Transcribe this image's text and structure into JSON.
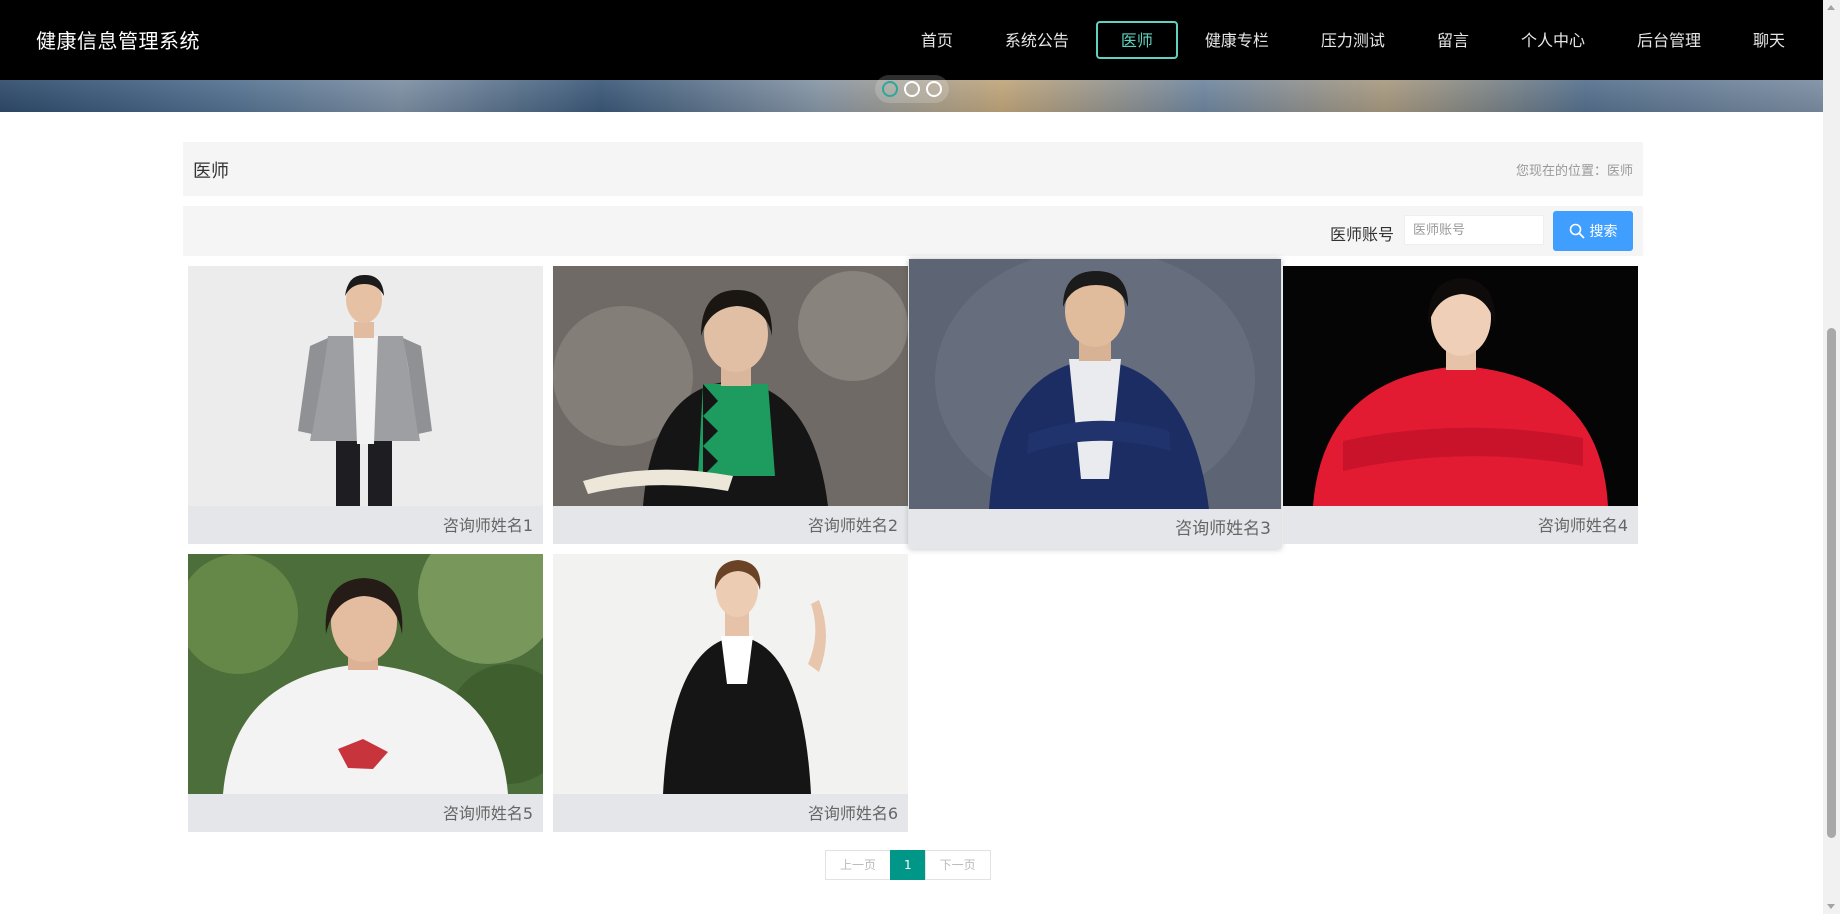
{
  "app": {
    "title": "健康信息管理系统"
  },
  "nav": {
    "items": [
      {
        "label": "首页",
        "active": false
      },
      {
        "label": "系统公告",
        "active": false
      },
      {
        "label": "医师",
        "active": true
      },
      {
        "label": "健康专栏",
        "active": false
      },
      {
        "label": "压力测试",
        "active": false
      },
      {
        "label": "留言",
        "active": false
      },
      {
        "label": "个人中心",
        "active": false
      },
      {
        "label": "后台管理",
        "active": false
      },
      {
        "label": "聊天",
        "active": false
      }
    ]
  },
  "carousel": {
    "slide_count": 3,
    "active_index": 0
  },
  "breadcrumb": {
    "title": "医师",
    "location_prefix": "您现在的位置：",
    "location_current": "医师"
  },
  "search": {
    "label": "医师账号",
    "placeholder": "医师账号",
    "value": "",
    "button_label": "搜索",
    "button_color": "#409eff"
  },
  "doctors": [
    {
      "name": "咨询师姓名1",
      "photo": "man-silver-jacket"
    },
    {
      "name": "咨询师姓名2",
      "photo": "woman-green-top-reading"
    },
    {
      "name": "咨询师姓名3",
      "photo": "man-blue-suit-arms-crossed"
    },
    {
      "name": "咨询师姓名4",
      "photo": "woman-red-blouse"
    },
    {
      "name": "咨询师姓名5",
      "photo": "woman-white-blouse-outdoor"
    },
    {
      "name": "咨询师姓名6",
      "photo": "woman-black-suit"
    }
  ],
  "pagination": {
    "prev_label": "上一页",
    "current_page": "1",
    "next_label": "下一页"
  },
  "colors": {
    "accent": "#5fd3c0",
    "page_active": "#009688",
    "topbar": "#000000"
  }
}
